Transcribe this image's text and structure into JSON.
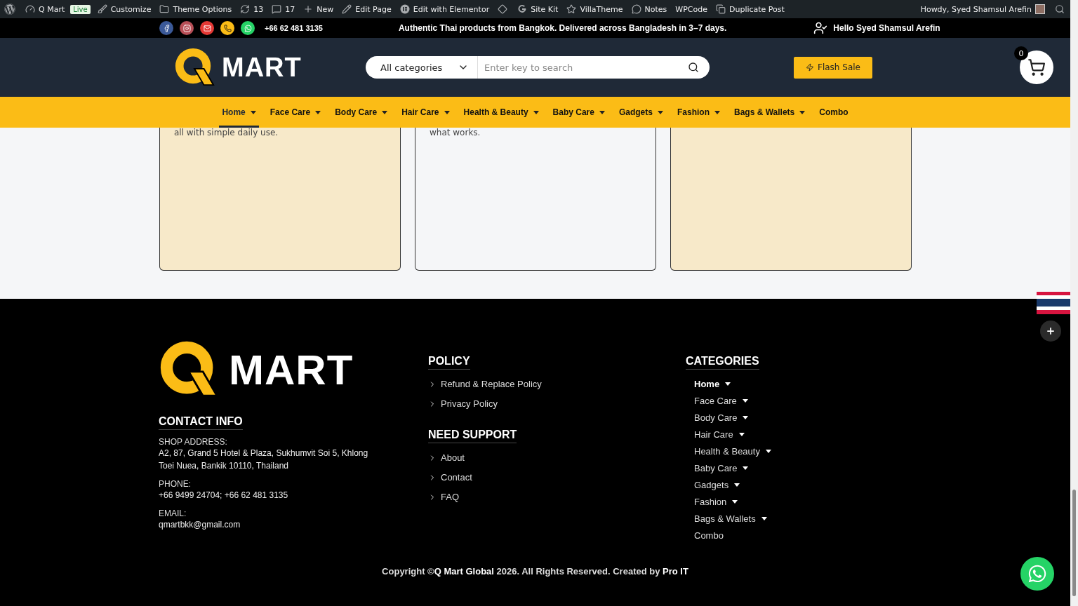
{
  "admin_bar": {
    "items": [
      {
        "kind": "icon"
      },
      {
        "label": "Q Mart"
      },
      {
        "label": "Customize"
      },
      {
        "label": "Theme Options"
      },
      {
        "label": "13"
      },
      {
        "label": "17"
      },
      {
        "label": "New"
      },
      {
        "label": "Edit Page"
      },
      {
        "label": "Edit with Elementor"
      },
      {
        "kind": "icon"
      },
      {
        "label": "Site Kit"
      },
      {
        "label": "VillaTheme"
      },
      {
        "label": "Notes"
      },
      {
        "label": "WPCode"
      },
      {
        "label": "Duplicate Post"
      }
    ],
    "badge": "Live",
    "howdy": "Howdy, Syed Shamsul Arefin"
  },
  "top_bar": {
    "socials": [
      {
        "color": "#3b5998"
      },
      {
        "color": "#b84f57"
      },
      {
        "color": "#e53935"
      },
      {
        "color": "#fbbc16"
      },
      {
        "color": "#25d366"
      }
    ],
    "phone": "+66 62 481 3135",
    "announcement": "Authentic Thai products from Bangkok. Delivered across Bangladesh in 3–7 days.",
    "greeting": "Hello Syed Shamsul Arefin"
  },
  "header": {
    "logo": "MART",
    "category": "All categories",
    "search_placeholder": "Enter key to search",
    "flash_sale": "Flash Sale",
    "cart_count": "0"
  },
  "nav": [
    {
      "label": "Home",
      "dropdown": true,
      "selected": true
    },
    {
      "label": "Face Care",
      "dropdown": true,
      "selected": false
    },
    {
      "label": "Body Care",
      "dropdown": true,
      "selected": false
    },
    {
      "label": "Hair Care",
      "dropdown": true,
      "selected": false
    },
    {
      "label": "Health & Beauty",
      "dropdown": true,
      "selected": false
    },
    {
      "label": "Baby Care",
      "dropdown": true,
      "selected": false
    },
    {
      "label": "Gadgets",
      "dropdown": true,
      "selected": false
    },
    {
      "label": "Fashion",
      "dropdown": true,
      "selected": false
    },
    {
      "label": "Bags & Wallets",
      "dropdown": true,
      "selected": false
    },
    {
      "label": "Combo",
      "dropdown": false,
      "selected": false
    }
  ],
  "cards": [
    {
      "kind": "tinted",
      "text": "all with simple daily use."
    },
    {
      "kind": "plain",
      "text": "what works."
    },
    {
      "kind": "tinted"
    }
  ],
  "footer": {
    "logo": "MART",
    "contact": {
      "title": "CONTACT INFO",
      "fields": [
        {
          "label": "SHOP ADDRESS:",
          "value": "A2, 87, Grand 5 Hotel & Plaza, Sukhumvit Soi 5, Khlong Toei Nuea, Bankik 10110, Thailand"
        },
        {
          "label": "PHONE:",
          "value": "+66 9499 24704; +66 62 481 3135"
        },
        {
          "label": "EMAIL:",
          "value": "qmartbkk@gmail.com"
        }
      ]
    },
    "policy": {
      "title": "POLICY",
      "links": [
        "Refund & Replace Policy",
        "Privacy Policy"
      ]
    },
    "support": {
      "title": "NEED SUPPORT",
      "links": [
        "About",
        "Contact",
        "FAQ"
      ]
    },
    "categories": {
      "title": "CATEGORIES",
      "items": [
        {
          "label": "Home",
          "dropdown": true,
          "selected": true
        },
        {
          "label": "Face Care",
          "dropdown": true,
          "selected": false
        },
        {
          "label": "Body Care",
          "dropdown": true,
          "selected": false
        },
        {
          "label": "Hair Care",
          "dropdown": true,
          "selected": false
        },
        {
          "label": "Health & Beauty",
          "dropdown": true,
          "selected": false
        },
        {
          "label": "Baby Care",
          "dropdown": true,
          "selected": false
        },
        {
          "label": "Gadgets",
          "dropdown": true,
          "selected": false
        },
        {
          "label": "Fashion",
          "dropdown": true,
          "selected": false
        },
        {
          "label": "Bags & Wallets",
          "dropdown": true,
          "selected": false
        },
        {
          "label": "Combo",
          "dropdown": false,
          "selected": false
        }
      ]
    },
    "copyright": "Copyright ©**Q Mart Global** 2026. All Rights Reserved. Created by **Pro IT**"
  }
}
